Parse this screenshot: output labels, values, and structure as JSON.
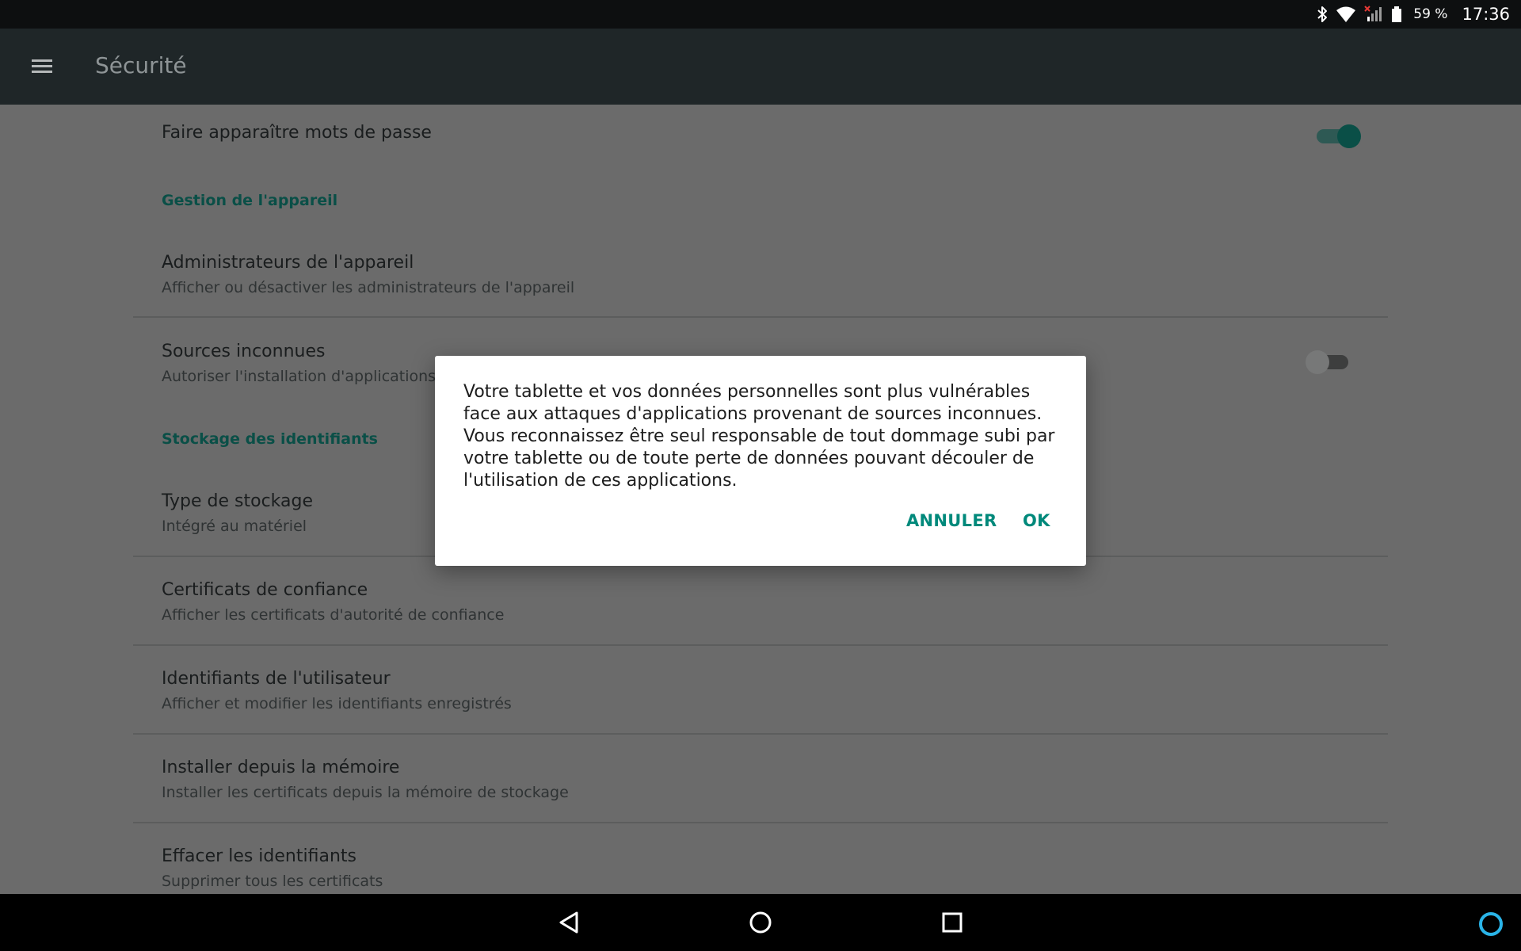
{
  "status_bar": {
    "battery": "59 %",
    "time": "17:36"
  },
  "app_bar": {
    "title": "Sécurité"
  },
  "settings": {
    "show_passwords": {
      "title": "Faire apparaître mots de passe",
      "enabled": true
    },
    "section_device": "Gestion de l'appareil",
    "device_admins": {
      "title": "Administrateurs de l'appareil",
      "subtitle": "Afficher ou désactiver les administrateurs de l'appareil"
    },
    "unknown_sources": {
      "title": "Sources inconnues",
      "subtitle": "Autoriser l'installation d'applications i",
      "enabled": false
    },
    "section_credentials": "Stockage des identifiants",
    "storage_type": {
      "title": "Type de stockage",
      "subtitle": "Intégré au matériel"
    },
    "trusted_certs": {
      "title": "Certificats de confiance",
      "subtitle": "Afficher les certificats d'autorité de confiance"
    },
    "user_credentials": {
      "title": "Identifiants de l'utilisateur",
      "subtitle": "Afficher et modifier les identifiants enregistrés"
    },
    "install_from_storage": {
      "title": "Installer depuis la mémoire",
      "subtitle": "Installer les certificats depuis la mémoire de stockage"
    },
    "clear_credentials": {
      "title": "Effacer les identifiants",
      "subtitle": "Supprimer tous les certificats"
    }
  },
  "dialog": {
    "message": "Votre tablette et vos données personnelles sont plus vulnérables face aux attaques d'applications provenant de sources inconnues. Vous reconnaissez être seul responsable de tout dommage subi par votre tablette ou de toute perte de données pouvant découler de l'utilisation de ces applications.",
    "cancel_label": "ANNULER",
    "ok_label": "OK"
  },
  "colors": {
    "accent": "#00897b",
    "app_bar": "#1f2628",
    "status_bar": "#0d0f10",
    "scrim_background": "#6b6b6b",
    "assistant": "#2ab4e8"
  },
  "icons": [
    "bluetooth-icon",
    "wifi-icon",
    "cell-signal-icon",
    "battery-icon",
    "menu-icon",
    "back-icon",
    "home-icon",
    "recents-icon",
    "assistant-icon"
  ]
}
